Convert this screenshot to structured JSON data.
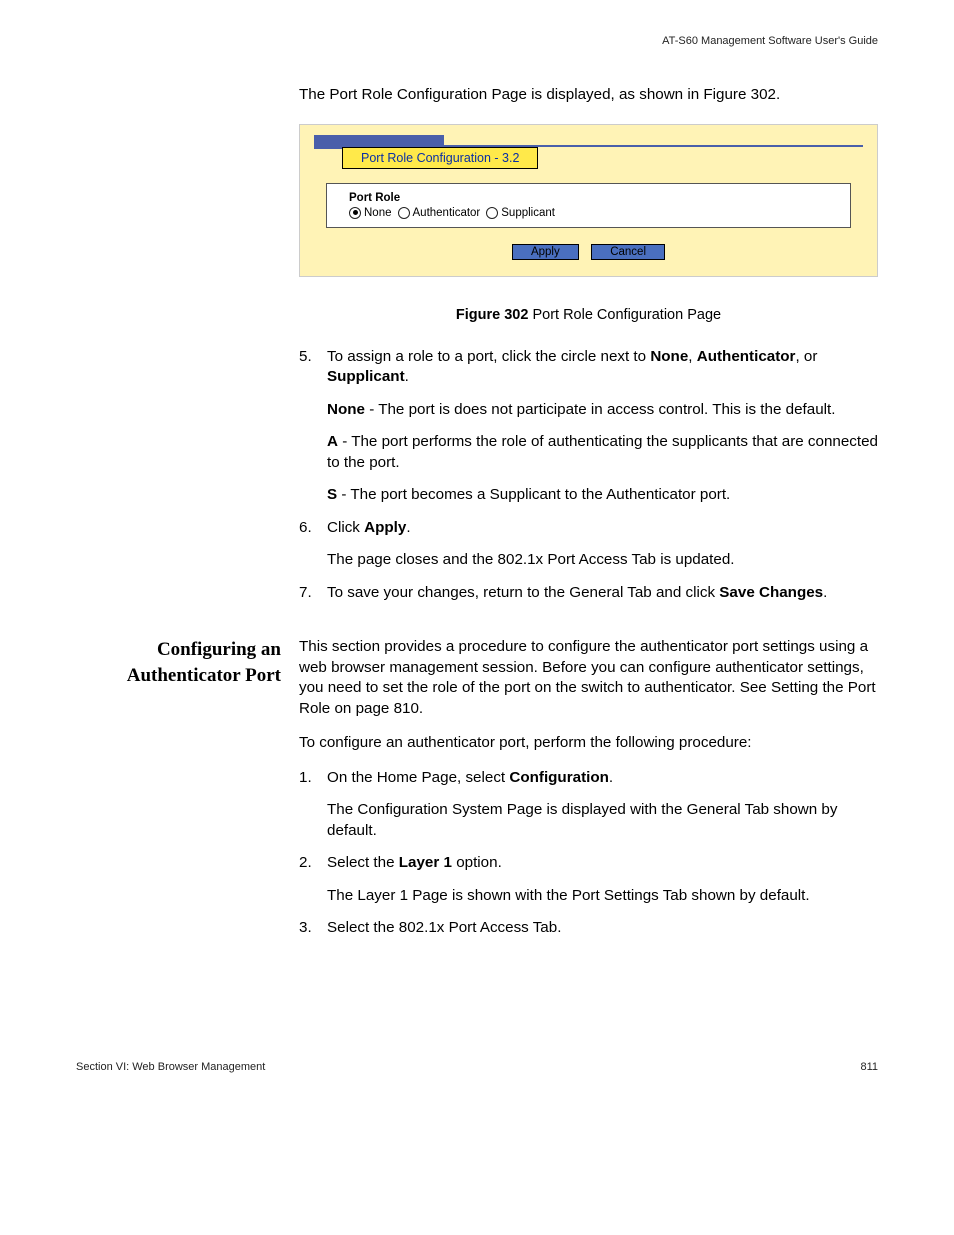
{
  "header": "AT-S60 Management Software User's Guide",
  "intro": "The Port Role Configuration Page is displayed, as shown in Figure 302.",
  "figure": {
    "title": "Port Role Configuration - 3.2",
    "section_label": "Port Role",
    "options": [
      {
        "label": "None",
        "selected": true
      },
      {
        "label": "Authenticator",
        "selected": false
      },
      {
        "label": "Supplicant",
        "selected": false
      }
    ],
    "apply": "Apply",
    "cancel": "Cancel"
  },
  "caption": {
    "bold": "Figure 302",
    "rest": "  Port Role Configuration Page"
  },
  "steps_a": [
    {
      "num": "5.",
      "main": [
        "To assign a role to a port, click the circle next to ",
        {
          "b": "None"
        },
        ", ",
        {
          "b": "Authenticator"
        },
        ", or ",
        {
          "b": "Supplicant"
        },
        "."
      ],
      "subs": [
        [
          {
            "b": "None"
          },
          " - The port is does not participate in access control. This is the default."
        ],
        [
          {
            "b": "A"
          },
          " - The port performs the role of authenticating the supplicants that are connected to the port."
        ],
        [
          {
            "b": "S"
          },
          " - The port becomes a Supplicant to the Authenticator port."
        ]
      ]
    },
    {
      "num": "6.",
      "main": [
        "Click ",
        {
          "b": "Apply"
        },
        "."
      ],
      "subs": [
        [
          "The page closes and the 802.1x Port Access Tab is updated."
        ]
      ]
    },
    {
      "num": "7.",
      "main": [
        "To save your changes, return to the General Tab and click ",
        {
          "b": "Save Changes"
        },
        "."
      ],
      "subs": []
    }
  ],
  "side_heading": "Configuring an Authenticator Port",
  "section_intro1": "This section provides a procedure to configure the authenticator port settings using a web browser management session. Before you can configure authenticator settings, you need to set the role of the port on the switch to authenticator. See Setting the Port Role on page 810.",
  "section_intro2": "To configure an authenticator port, perform the following procedure:",
  "steps_b": [
    {
      "num": "1.",
      "main": [
        "On the Home Page, select ",
        {
          "b": "Configuration"
        },
        "."
      ],
      "subs": [
        [
          "The Configuration System Page is displayed with the General Tab shown by default."
        ]
      ]
    },
    {
      "num": "2.",
      "main": [
        "Select the ",
        {
          "b": "Layer 1"
        },
        " option."
      ],
      "subs": [
        [
          "The Layer 1 Page is shown with the Port Settings Tab shown by default."
        ]
      ]
    },
    {
      "num": "3.",
      "main": [
        "Select the 802.1x Port Access Tab."
      ],
      "subs": []
    }
  ],
  "footer": {
    "left": "Section VI: Web Browser Management",
    "right": "811"
  }
}
